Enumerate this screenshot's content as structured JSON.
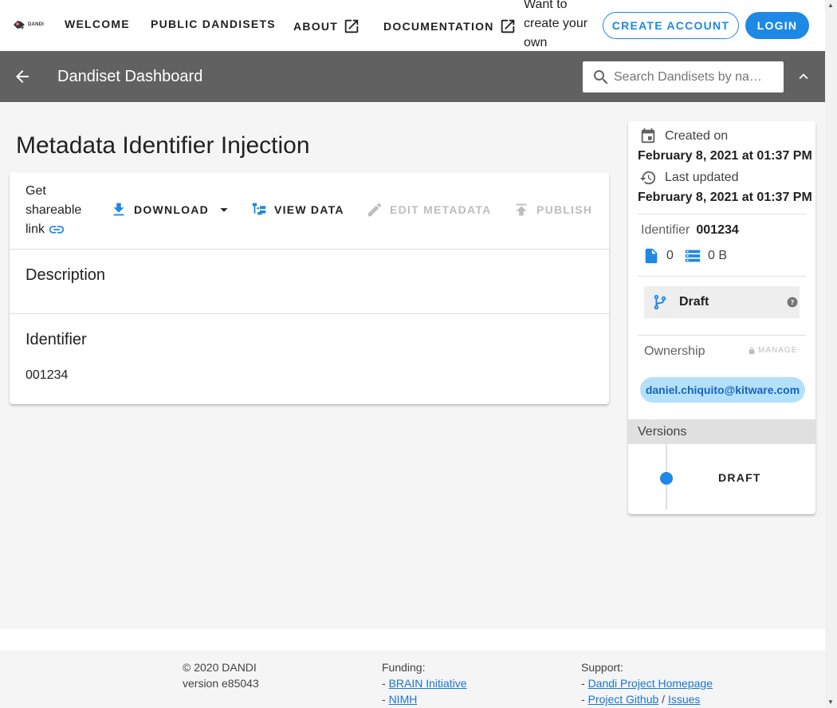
{
  "nav": {
    "logo_text": "DANDI",
    "welcome": "WELCOME",
    "public_dandisets": "PUBLIC DANDISETS",
    "about": "ABOUT",
    "documentation": "DOCUMENTATION",
    "want_text": "Want to create your own datasets?",
    "create_account": "CREATE ACCOUNT",
    "login": "LOGIN"
  },
  "dashbar": {
    "title": "Dandiset Dashboard",
    "search_placeholder": "Search Dandisets by na…"
  },
  "main": {
    "title": "Metadata Identifier Injection",
    "share_text": "Get shareable link",
    "toolbar": {
      "download": "DOWNLOAD",
      "view_data": "VIEW DATA",
      "edit_metadata": "EDIT METADATA",
      "publish": "PUBLISH"
    },
    "description_title": "Description",
    "identifier_title": "Identifier",
    "identifier_value": "001234"
  },
  "side": {
    "created_label": "Created on",
    "created_date": "February 8, 2021 at 01:37 PM",
    "updated_label": "Last updated",
    "updated_date": "February 8, 2021 at 01:37 PM",
    "identifier_label": "Identifier",
    "identifier_value": "001234",
    "file_count": "0",
    "size": "0 B",
    "draft_label": "Draft",
    "ownership_label": "Ownership",
    "manage_label": "MANAGE",
    "owner_email": "daniel.chiquito@kitware.com",
    "versions_label": "Versions",
    "version_draft": "DRAFT"
  },
  "footer": {
    "copyright": "© 2020 DANDI",
    "version": "version e85043",
    "funding_label": "Funding:",
    "funding_1": "BRAIN Initiative",
    "funding_2": "NIMH",
    "support_label": "Support:",
    "support_1": "Dandi Project Homepage",
    "support_2": "Project Github",
    "support_3": "Issues",
    "dash": "-",
    "slash": "/"
  },
  "colors": {
    "accent": "#1e88e5",
    "dashbar": "#616161",
    "chip": "#b3e0fa"
  }
}
